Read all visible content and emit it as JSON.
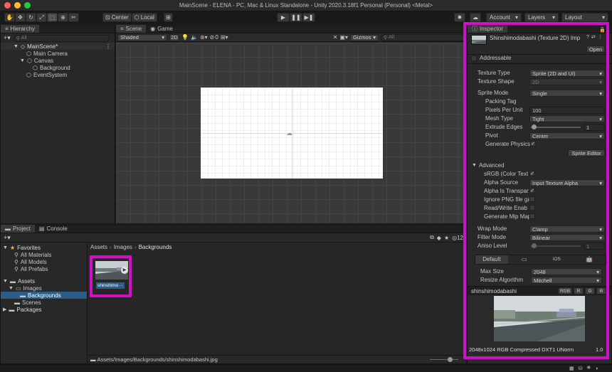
{
  "window": {
    "title": "MainScene - ELENA - PC, Mac & Linux Standalone - Unity 2020.3.18f1 Personal (Personal) <Metal>"
  },
  "toolbar": {
    "pivot": "Center",
    "space": "Local",
    "account": "Account",
    "layers": "Layers",
    "layout": "Layout"
  },
  "hierarchy": {
    "tab": "Hierarchy",
    "search": "All",
    "items": [
      {
        "label": "MainScene*"
      },
      {
        "label": "Main Camera"
      },
      {
        "label": "Canvas"
      },
      {
        "label": "Background"
      },
      {
        "label": "EventSystem"
      }
    ]
  },
  "scene": {
    "tabs": [
      {
        "label": "Scene"
      },
      {
        "label": "Game"
      }
    ],
    "shading": "Shaded",
    "mode2d": "2D",
    "fx_count": "0",
    "gizmos": "Gizmos",
    "search": "All"
  },
  "project": {
    "tabs": [
      {
        "label": "Project"
      },
      {
        "label": "Console"
      }
    ],
    "favorites": "Favorites",
    "fav_items": [
      "All Materials",
      "All Models",
      "All Prefabs"
    ],
    "assets": "Assets",
    "images": "Images",
    "backgrounds": "Backgrounds",
    "scenes": "Scenes",
    "packages": "Packages",
    "breadcrumb": [
      "Assets",
      "Images",
      "Backgrounds"
    ],
    "asset_label": "shinshimo···",
    "path": "Assets/Images/Backgrounds/shinshimodabashi.jpg",
    "count": "12"
  },
  "inspector": {
    "tab": "Inspector",
    "asset_title": "Shinshimodabashi (Texture 2D) Imp",
    "open": "Open",
    "addressable": "Addressable",
    "texture_type_label": "Texture Type",
    "texture_type": "Sprite (2D and UI)",
    "texture_shape_label": "Texture Shape",
    "texture_shape": "2D",
    "sprite_mode_label": "Sprite Mode",
    "sprite_mode": "Single",
    "packing_tag_label": "Packing Tag",
    "ppu_label": "Pixels Per Unit",
    "ppu": "100",
    "mesh_type_label": "Mesh Type",
    "mesh_type": "Tight",
    "extrude_label": "Extrude Edges",
    "extrude": "1",
    "pivot_label": "Pivot",
    "pivot": "Center",
    "gen_physics_label": "Generate Physics",
    "sprite_editor": "Sprite Editor",
    "advanced": "Advanced",
    "srgb_label": "sRGB (Color Text",
    "alpha_source_label": "Alpha Source",
    "alpha_source": "Input Texture Alpha",
    "alpha_transp_label": "Alpha Is Transpar",
    "ignore_png_label": "Ignore PNG file ga",
    "rw_label": "Read/Write Enab",
    "mip_label": "Generate Mip Map",
    "wrap_label": "Wrap Mode",
    "wrap": "Clamp",
    "filter_label": "Filter Mode",
    "filter": "Bilinear",
    "aniso_label": "Aniso Level",
    "aniso": "1",
    "platform_default": "Default",
    "platform_ios": "iOS",
    "max_size_label": "Max Size",
    "max_size": "2048",
    "resize_label": "Resize Algorithm",
    "resize": "Mitchell",
    "preview_name": "shinshimodabashi",
    "channels": [
      "RGB",
      "R",
      "G",
      "B"
    ],
    "preview_info": "2048x1024 RGB Compressed DXT1 UNorm",
    "preview_mip": "1.0"
  },
  "colors": {
    "highlight": "#d010c7",
    "selection": "#2c5d87"
  }
}
